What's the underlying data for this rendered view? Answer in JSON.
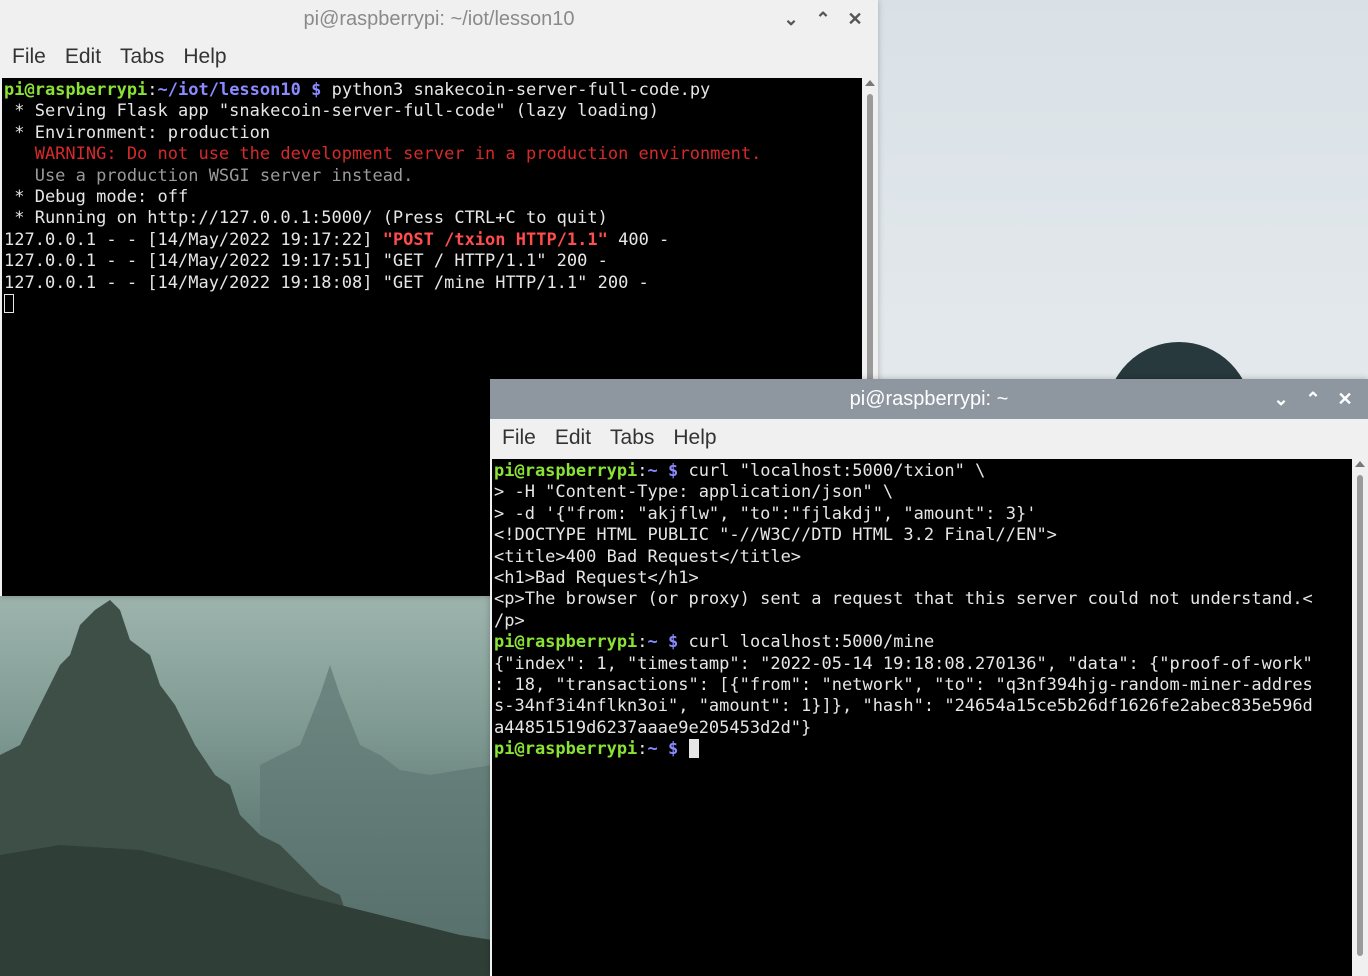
{
  "windows": [
    {
      "title": "pi@raspberrypi: ~/iot/lesson10",
      "menu": [
        "File",
        "Edit",
        "Tabs",
        "Help"
      ],
      "prompt_user": "pi@raspberrypi",
      "prompt_sep": ":",
      "prompt_path": "~/iot/lesson10",
      "prompt_symbol": "$",
      "command": "python3 snakecoin-server-full-code.py",
      "output": {
        "l1": " * Serving Flask app \"snakecoin-server-full-code\" (lazy loading)",
        "l2": " * Environment: production",
        "warning": "   WARNING: Do not use the development server in a production environment.",
        "wsgi": "   Use a production WSGI server instead.",
        "l5": " * Debug mode: off",
        "l6": " * Running on http://127.0.0.1:5000/ (Press CTRL+C to quit)",
        "log1_pre": "127.0.0.1 - - [14/May/2022 19:17:22] ",
        "log1_req": "\"POST /txion HTTP/1.1\"",
        "log1_post": " 400 -",
        "log2": "127.0.0.1 - - [14/May/2022 19:17:51] \"GET / HTTP/1.1\" 200 -",
        "log3": "127.0.0.1 - - [14/May/2022 19:18:08] \"GET /mine HTTP/1.1\" 200 -"
      }
    },
    {
      "title": "pi@raspberrypi: ~",
      "menu": [
        "File",
        "Edit",
        "Tabs",
        "Help"
      ],
      "prompt_user": "pi@raspberrypi",
      "prompt_sep": ":",
      "prompt_path": "~",
      "prompt_symbol": "$",
      "cmd1": "curl \"localhost:5000/txion\" \\",
      "cont1": "> -H \"Content-Type: application/json\" \\",
      "cont2": "> -d '{\"from: \"akjflw\", \"to\":\"fjlakdj\", \"amount\": 3}'",
      "resp1": "<!DOCTYPE HTML PUBLIC \"-//W3C//DTD HTML 3.2 Final//EN\">",
      "resp2": "<title>400 Bad Request</title>",
      "resp3": "<h1>Bad Request</h1>",
      "resp4": "<p>The browser (or proxy) sent a request that this server could not understand.<",
      "resp5": "/p>",
      "cmd2": "curl localhost:5000/mine",
      "json1": "{\"index\": 1, \"timestamp\": \"2022-05-14 19:18:08.270136\", \"data\": {\"proof-of-work\"",
      "json2": ": 18, \"transactions\": [{\"from\": \"network\", \"to\": \"q3nf394hjg-random-miner-addres",
      "json3": "s-34nf3i4nflkn3oi\", \"amount\": 1}]}, \"hash\": \"24654a15ce5b26df1626fe2abec835e596d",
      "json4": "a44851519d6237aaae9e205453d2d\"}"
    }
  ],
  "icons": {
    "minimize": "chevron-down-icon",
    "maximize": "chevron-up-icon",
    "close": "close-icon"
  },
  "colors": {
    "prompt_user": "#8ae234",
    "prompt_path": "#8b8bff",
    "warning": "#d62a2a",
    "error_request": "#ff4c4c",
    "active_titlebar": "#8e969f"
  }
}
